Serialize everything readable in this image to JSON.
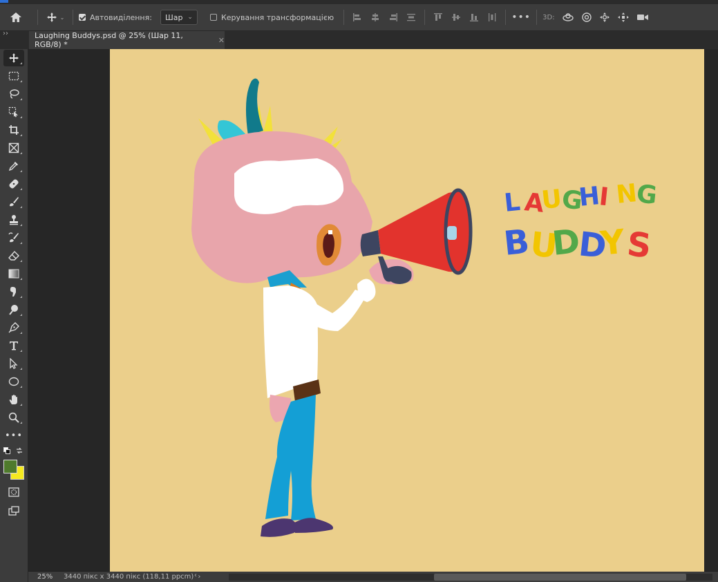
{
  "options_bar": {
    "auto_select_label": "Автовиділення:",
    "auto_select_checked": true,
    "layer_select_value": "Шар",
    "transform_controls_label": "Керування трансформацією",
    "three_d_label": "3D:"
  },
  "document": {
    "tab_title": "Laughing Buddys.psd @ 25% (Шар 11, RGB/8) *"
  },
  "artwork": {
    "title_line1": "LAUGHING",
    "title_line2": "BUDDYS",
    "line1_colors": [
      "#3a5fd8",
      "#e53935",
      "#f2c500",
      "#52a84a",
      "#3a5fd8",
      "#e53935",
      "#f2c500",
      "#52a84a"
    ],
    "line2_colors": [
      "#3a5fd8",
      "#f2c500",
      "#52a84a",
      "#3a5fd8",
      "#f2c500",
      "#e53935"
    ]
  },
  "status": {
    "zoom": "25%",
    "doc_size": "3440 пікс x 3440 пікс (118,11 ppcm)"
  },
  "colors": {
    "foreground": "#4f7a2c",
    "background": "#f5ea1f",
    "canvas": "#ebcf8b"
  }
}
